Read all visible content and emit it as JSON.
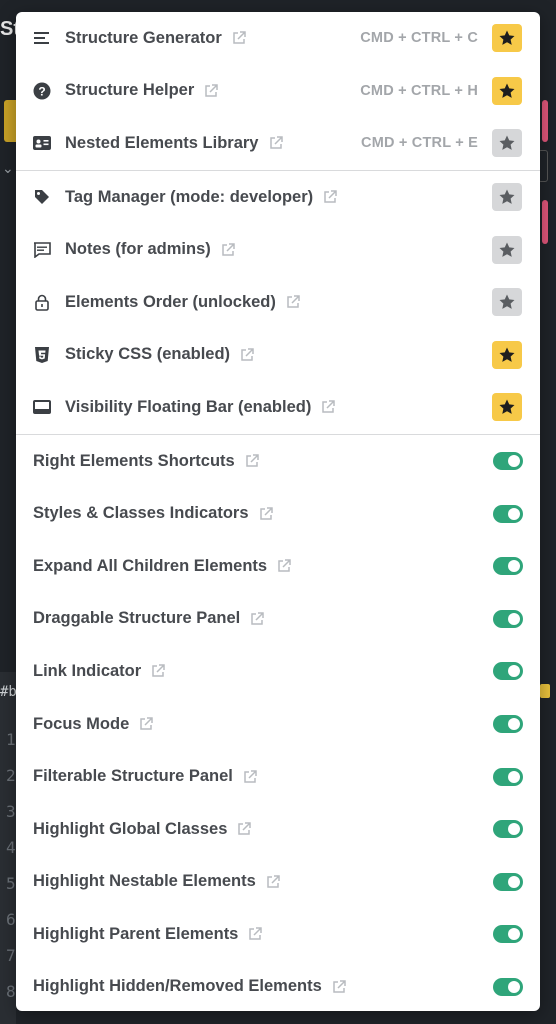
{
  "background": {
    "title_fragment": "St",
    "hash_fragment": "#b",
    "line_numbers": [
      "1",
      "2",
      "3",
      "4",
      "5",
      "6",
      "7",
      "8"
    ]
  },
  "colors": {
    "star_active": "#f7c948",
    "star_inactive": "#d6d7d9",
    "toggle_on": "#2fa57a"
  },
  "menu": {
    "tools": [
      {
        "label": "Structure Generator",
        "icon": "list-icon",
        "shortcut": "CMD + CTRL + C",
        "starred": true
      },
      {
        "label": "Structure Helper",
        "icon": "question-circle-icon",
        "shortcut": "CMD + CTRL + H",
        "starred": true
      },
      {
        "label": "Nested Elements Library",
        "icon": "id-card-icon",
        "shortcut": "CMD + CTRL + E",
        "starred": false
      }
    ],
    "features": [
      {
        "label": "Tag Manager (mode: developer)",
        "icon": "tag-icon",
        "starred": false
      },
      {
        "label": "Notes (for admins)",
        "icon": "comment-icon",
        "starred": false
      },
      {
        "label": "Elements Order (unlocked)",
        "icon": "lock-icon",
        "starred": false
      },
      {
        "label": "Sticky CSS (enabled)",
        "icon": "css3-icon",
        "starred": true
      },
      {
        "label": "Visibility Floating Bar (enabled)",
        "icon": "floating-bar-icon",
        "starred": true
      }
    ],
    "toggles": [
      {
        "label": "Right Elements Shortcuts",
        "enabled": true
      },
      {
        "label": "Styles & Classes Indicators",
        "enabled": true
      },
      {
        "label": "Expand All Children Elements",
        "enabled": true
      },
      {
        "label": "Draggable Structure Panel",
        "enabled": true
      },
      {
        "label": "Link Indicator",
        "enabled": true
      },
      {
        "label": "Focus Mode",
        "enabled": true
      },
      {
        "label": "Filterable Structure Panel",
        "enabled": true
      },
      {
        "label": "Highlight Global Classes",
        "enabled": true
      },
      {
        "label": "Highlight Nestable Elements",
        "enabled": true
      },
      {
        "label": "Highlight Parent Elements",
        "enabled": true
      },
      {
        "label": "Highlight Hidden/Removed Elements",
        "enabled": true
      }
    ]
  }
}
